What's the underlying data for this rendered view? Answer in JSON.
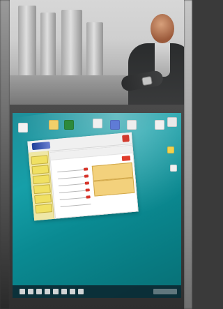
{
  "scene": {
    "app_window": {
      "title_line_1": "",
      "title_line_2": ""
    },
    "taskbar": {
      "icons": [
        "start-icon",
        "search-icon",
        "task-view-icon",
        "file-explorer-icon",
        "browser-icon",
        "mail-icon",
        "store-icon",
        "app-icon",
        "tray-area"
      ]
    }
  }
}
